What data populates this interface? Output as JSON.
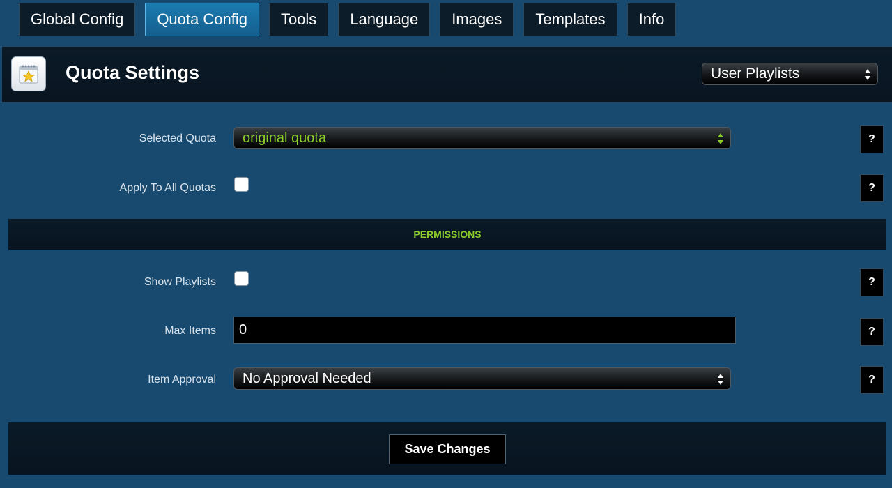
{
  "tabs": [
    {
      "label": "Global Config",
      "active": false
    },
    {
      "label": "Quota Config",
      "active": true
    },
    {
      "label": "Tools",
      "active": false
    },
    {
      "label": "Language",
      "active": false
    },
    {
      "label": "Images",
      "active": false
    },
    {
      "label": "Templates",
      "active": false
    },
    {
      "label": "Info",
      "active": false
    }
  ],
  "header": {
    "title": "Quota Settings",
    "icon": "notepad-star-icon",
    "section_select": "User Playlists"
  },
  "form": {
    "selected_quota": {
      "label": "Selected Quota",
      "value": "original quota",
      "help": "?"
    },
    "apply_all": {
      "label": "Apply To All Quotas",
      "checked": false,
      "help": "?"
    },
    "permissions_heading": "PERMISSIONS",
    "show_playlists": {
      "label": "Show Playlists",
      "checked": false,
      "help": "?"
    },
    "max_items": {
      "label": "Max Items",
      "value": "0",
      "help": "?"
    },
    "item_approval": {
      "label": "Item Approval",
      "value": "No Approval Needed",
      "help": "?"
    }
  },
  "footer": {
    "save_label": "Save Changes"
  },
  "colors": {
    "background": "#184a70",
    "accent_green": "#8ccf2b",
    "active_tab": "#1b7bb1",
    "dark_panel": "#0b1a27"
  }
}
